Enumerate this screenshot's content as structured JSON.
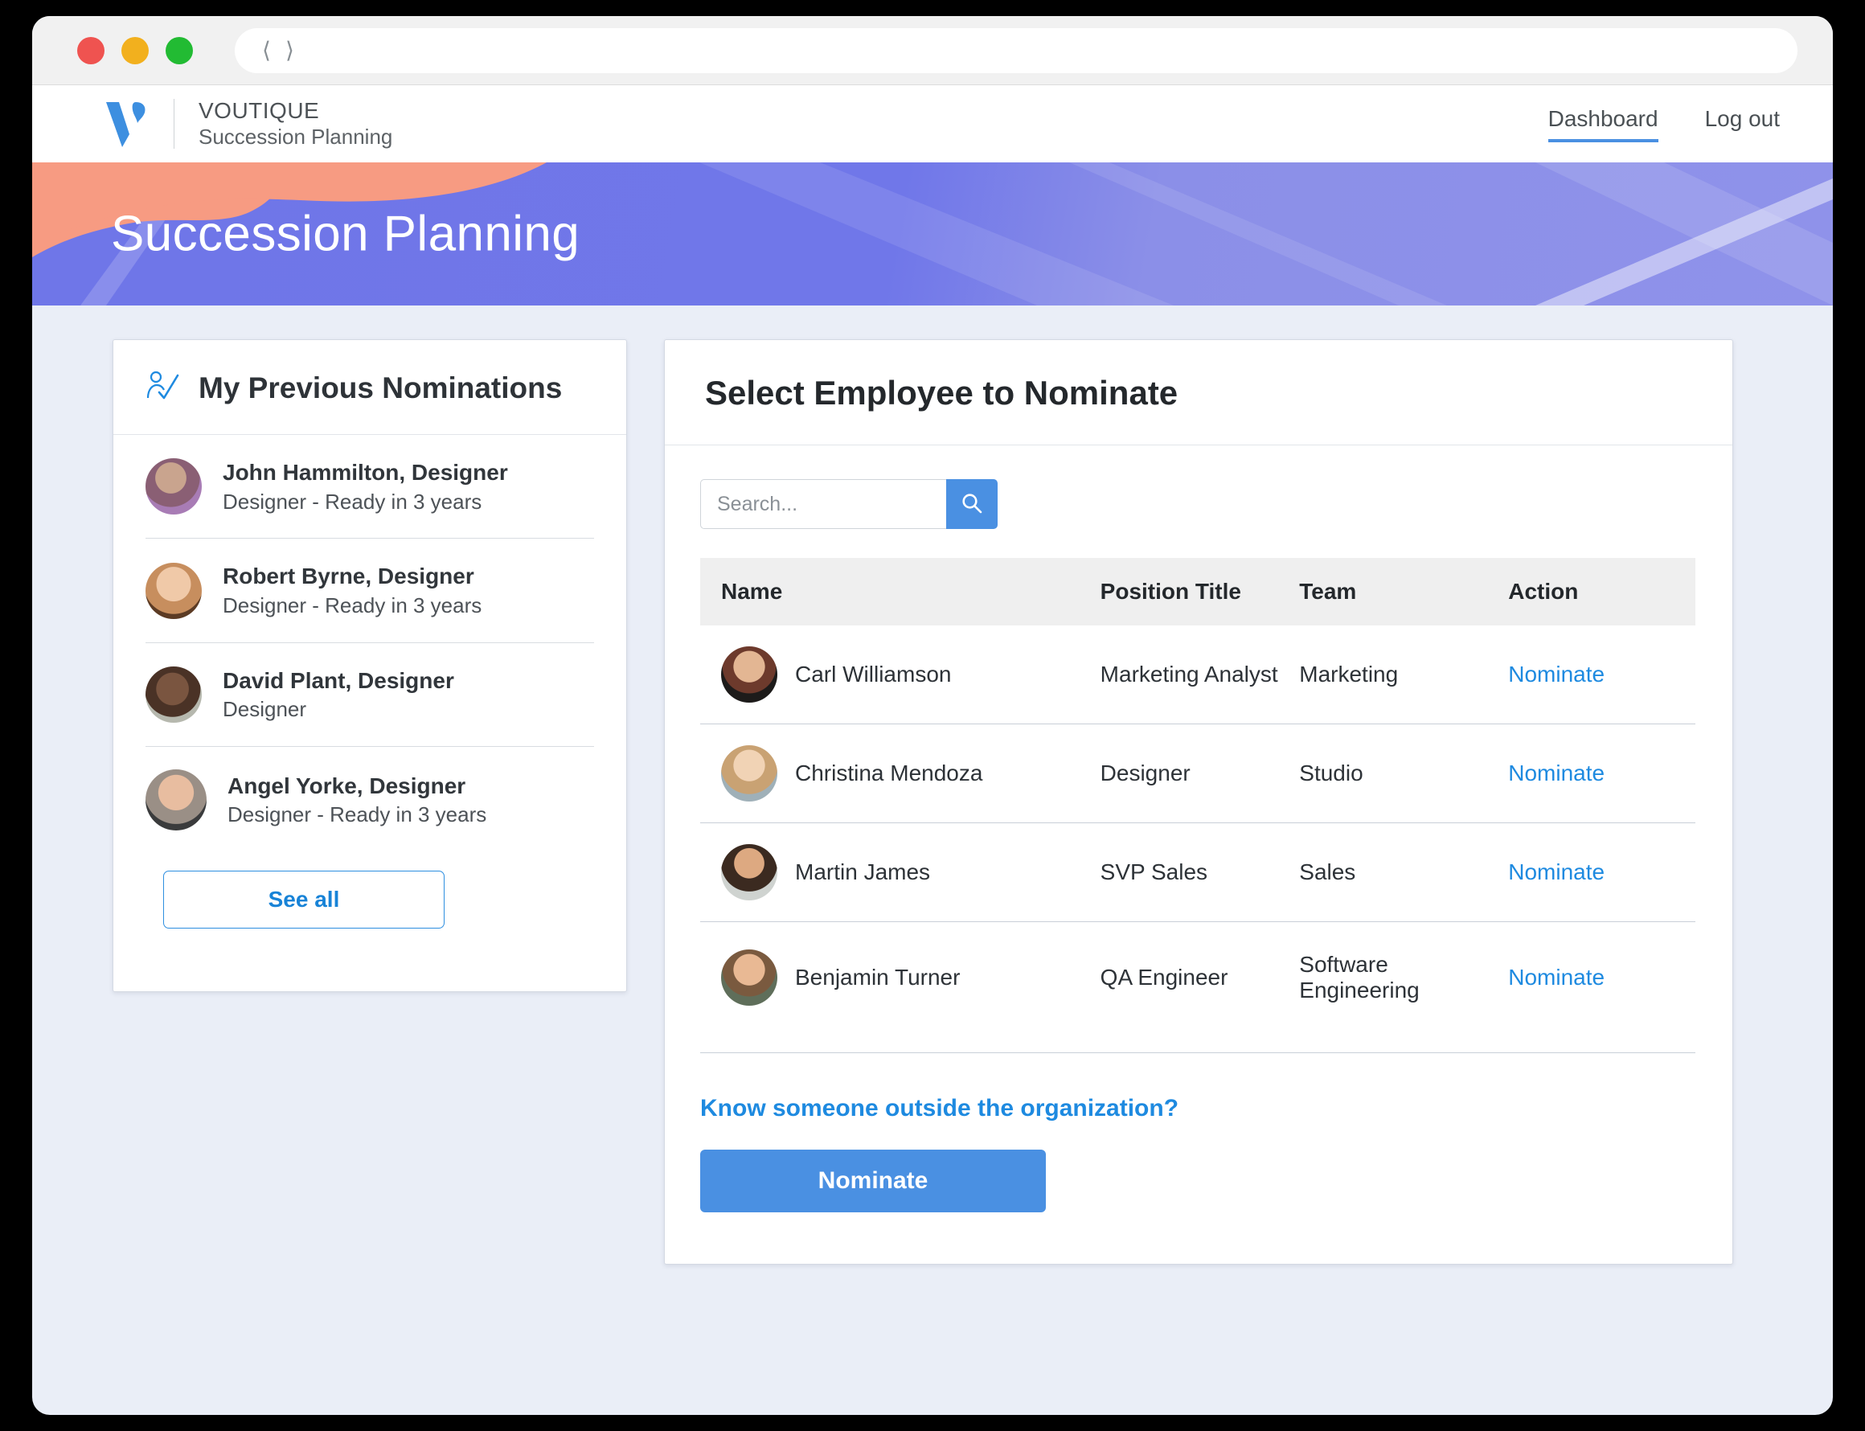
{
  "browser": {
    "back_icon": "chevron-left-icon",
    "forward_icon": "chevron-right-icon",
    "url": ""
  },
  "header": {
    "brand_title": "VOUTIQUE",
    "brand_subtitle": "Succession Planning",
    "nav": [
      {
        "label": "Dashboard",
        "active": true
      },
      {
        "label": "Log out",
        "active": false
      }
    ]
  },
  "hero": {
    "title": "Succession Planning",
    "gradient_from": "#6f76e8",
    "gradient_to": "#8f92ea",
    "blob_color": "#f79b82"
  },
  "left_panel": {
    "title": "My Previous Nominations",
    "icon": "person-check-icon",
    "nominations": [
      {
        "name": "John Hammilton, Designer",
        "detail": "Designer - Ready in 3 years"
      },
      {
        "name": "Robert Byrne, Designer",
        "detail": "Designer - Ready in 3 years"
      },
      {
        "name": "David Plant, Designer",
        "detail": "Designer"
      },
      {
        "name": "Angel Yorke, Designer",
        "detail": "Designer - Ready in 3 years"
      }
    ],
    "see_all_label": "See all"
  },
  "right_panel": {
    "title": "Select Employee to Nominate",
    "search": {
      "value": "",
      "placeholder": "Search...",
      "button_icon": "search-icon"
    },
    "table": {
      "columns": [
        "Name",
        "Position Title",
        "Team",
        "Action"
      ],
      "rows": [
        {
          "name": "Carl Williamson",
          "position": "Marketing Analyst",
          "team": "Marketing",
          "action": "Nominate"
        },
        {
          "name": "Christina Mendoza",
          "position": "Designer",
          "team": "Studio",
          "action": "Nominate"
        },
        {
          "name": "Martin James",
          "position": "SVP Sales",
          "team": "Sales",
          "action": "Nominate"
        },
        {
          "name": "Benjamin Turner",
          "position": "QA Engineer",
          "team": "Software Engineering",
          "action": "Nominate"
        }
      ]
    },
    "outside_link": "Know someone outside the organization?",
    "nominate_button": "Nominate"
  },
  "colors": {
    "accent_blue": "#4a90e2",
    "link_blue": "#1e8ae0",
    "page_background": "#eaeef7",
    "table_header_bg": "#efefef"
  }
}
